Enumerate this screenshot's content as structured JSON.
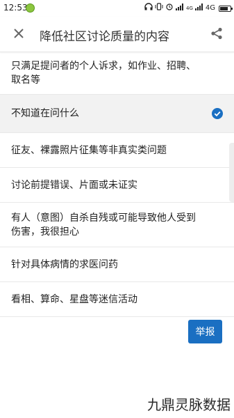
{
  "status_bar": {
    "time": "12:53",
    "network_1": "4G",
    "network_2": "4G",
    "icons": [
      "headphones-icon",
      "vibrate-icon",
      "alarm-icon",
      "signal-icon",
      "signal-icon",
      "battery-icon"
    ]
  },
  "toolbar": {
    "title": "降低社区讨论质量的内容",
    "close_icon": "close-icon",
    "share_icon": "share-icon"
  },
  "options": [
    {
      "label": "只满足提问者的个人诉求，如作业、招聘、取名等",
      "selected": false
    },
    {
      "label": "不知道在问什么",
      "selected": true
    },
    {
      "label": "征友、裸露照片征集等非真实类问题",
      "selected": false
    },
    {
      "label": "讨论前提错误、片面或未证实",
      "selected": false
    },
    {
      "label": "有人（意图）自杀自残或可能导致他人受到伤害，我很担心",
      "selected": false
    },
    {
      "label": "针对具体病情的求医问药",
      "selected": false
    },
    {
      "label": "看相、算命、星盘等迷信活动",
      "selected": false
    }
  ],
  "report_button": {
    "label": "举报"
  },
  "watermark": "九鼎灵脉数据",
  "colors": {
    "accent": "#1a6fc2",
    "selected_bg": "#f2f2f2"
  }
}
